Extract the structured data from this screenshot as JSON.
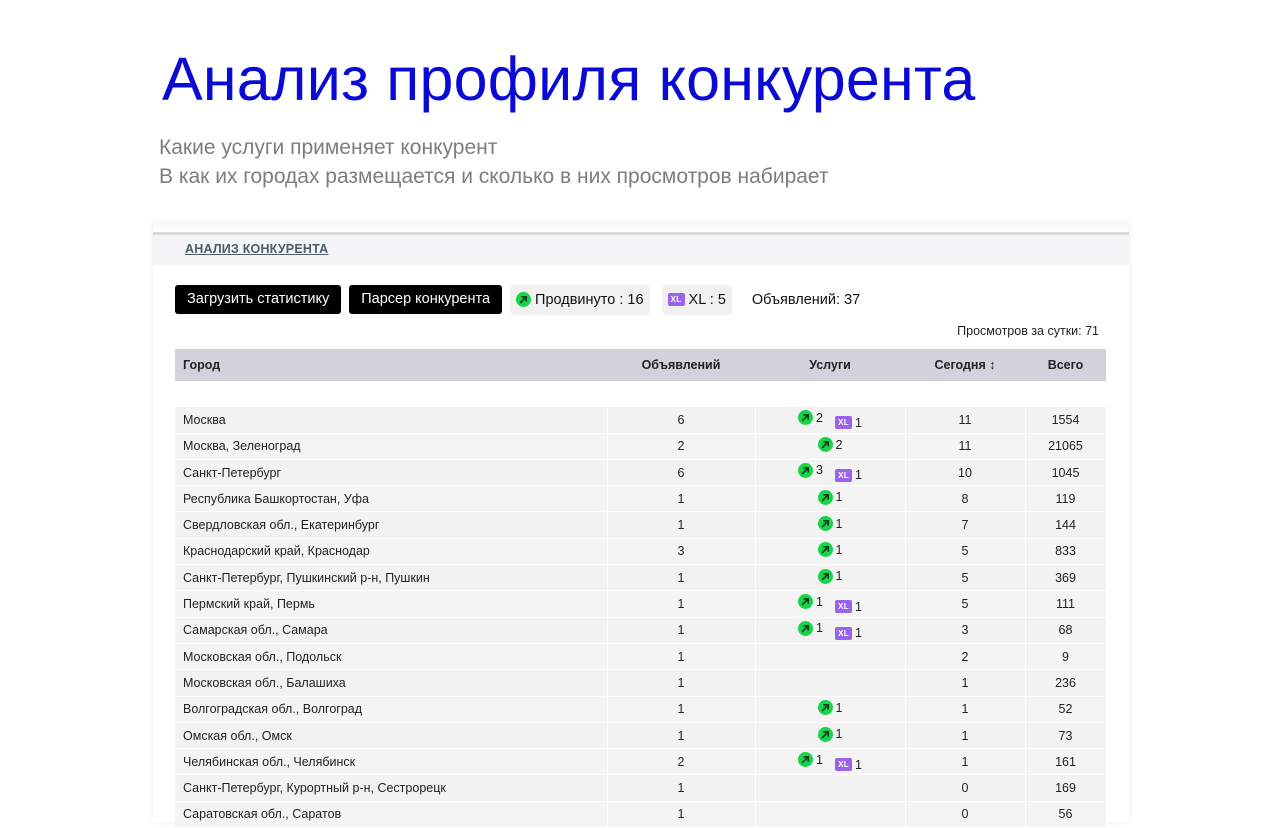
{
  "hero": {
    "title": "Анализ профиля конкурента",
    "subtitle_line1": "Какие услуги применяет конкурент",
    "subtitle_line2": "В как их городах размещается и сколько в них просмотров набирает"
  },
  "panel": {
    "header_link": "АНАЛИЗ КОНКУРЕНТА",
    "toolbar": {
      "load_stats_label": "Загрузить статистику",
      "parser_label": "Парсер конкурента",
      "promoted_label": "Продвинуто : 16",
      "xl_label": "XL : 5",
      "ads_total_label": "Объявлений: 37"
    },
    "views_per_day": "Просмотров за сутки: 71"
  },
  "colors": {
    "title": "#0a0ad4",
    "promo_icon": "#18d44a",
    "xl_icon": "#9a63ea",
    "table_header_bg": "#d0d3dc"
  },
  "icons": {
    "promo": "promo-arrow-icon",
    "xl": "xl-badge-icon"
  },
  "table": {
    "headers": {
      "city": "Город",
      "ads": "Объявлений",
      "services": "Услуги",
      "today": "Сегодня ↕",
      "total": "Всего"
    },
    "xl_icon_text": "XL",
    "rows": [
      {
        "city": "Москва",
        "ads": "6",
        "promo": "2",
        "xl": "1",
        "today": "11",
        "total": "1554"
      },
      {
        "city": "Москва, Зеленоград",
        "ads": "2",
        "promo": "2",
        "xl": null,
        "today": "11",
        "total": "21065"
      },
      {
        "city": "Санкт-Петербург",
        "ads": "6",
        "promo": "3",
        "xl": "1",
        "today": "10",
        "total": "1045"
      },
      {
        "city": "Республика Башкортостан, Уфа",
        "ads": "1",
        "promo": "1",
        "xl": null,
        "today": "8",
        "total": "119"
      },
      {
        "city": "Свердловская обл., Екатеринбург",
        "ads": "1",
        "promo": "1",
        "xl": null,
        "today": "7",
        "total": "144"
      },
      {
        "city": "Краснодарский край, Краснодар",
        "ads": "3",
        "promo": "1",
        "xl": null,
        "today": "5",
        "total": "833"
      },
      {
        "city": "Санкт-Петербург, Пушкинский р-н, Пушкин",
        "ads": "1",
        "promo": "1",
        "xl": null,
        "today": "5",
        "total": "369"
      },
      {
        "city": "Пермский край, Пермь",
        "ads": "1",
        "promo": "1",
        "xl": "1",
        "today": "5",
        "total": "111"
      },
      {
        "city": "Самарская обл., Самара",
        "ads": "1",
        "promo": "1",
        "xl": "1",
        "today": "3",
        "total": "68"
      },
      {
        "city": "Московская обл., Подольск",
        "ads": "1",
        "promo": null,
        "xl": null,
        "today": "2",
        "total": "9"
      },
      {
        "city": "Московская обл., Балашиха",
        "ads": "1",
        "promo": null,
        "xl": null,
        "today": "1",
        "total": "236"
      },
      {
        "city": "Волгоградская обл., Волгоград",
        "ads": "1",
        "promo": "1",
        "xl": null,
        "today": "1",
        "total": "52"
      },
      {
        "city": "Омская обл., Омск",
        "ads": "1",
        "promo": "1",
        "xl": null,
        "today": "1",
        "total": "73"
      },
      {
        "city": "Челябинская обл., Челябинск",
        "ads": "2",
        "promo": "1",
        "xl": "1",
        "today": "1",
        "total": "161"
      },
      {
        "city": "Санкт-Петербург, Курортный р-н, Сестрорецк",
        "ads": "1",
        "promo": null,
        "xl": null,
        "today": "0",
        "total": "169"
      },
      {
        "city": "Саратовская обл., Саратов",
        "ads": "1",
        "promo": null,
        "xl": null,
        "today": "0",
        "total": "56"
      }
    ]
  }
}
